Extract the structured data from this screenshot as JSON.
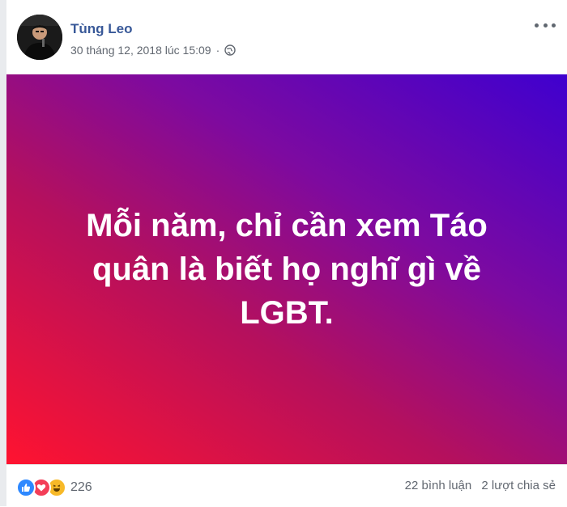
{
  "post": {
    "author": "Tùng Leo",
    "timestamp": "30 tháng 12, 2018 lúc 15:09",
    "separator": "·",
    "privacy_icon": "globe-icon",
    "more_icon": "more-options-icon"
  },
  "banner": {
    "line1": "Mỗi năm, chỉ cần xem Táo",
    "line2": "quân là biết họ nghĩ gì về LGBT.",
    "gradient_colors": [
      "#ff1330",
      "#b5105d",
      "#7d0aa0",
      "#3f00cf"
    ],
    "text_color": "#ffffff"
  },
  "footer": {
    "reaction_icons": [
      "like-icon",
      "love-icon",
      "haha-icon"
    ],
    "reaction_count": "226",
    "comments": "22 bình luận",
    "shares": "2 lượt chia sẻ"
  },
  "colors": {
    "author_link": "#385898",
    "meta_text": "#616770",
    "like": "#2d88ff",
    "love": "#f33e58",
    "haha": "#f7b928"
  }
}
